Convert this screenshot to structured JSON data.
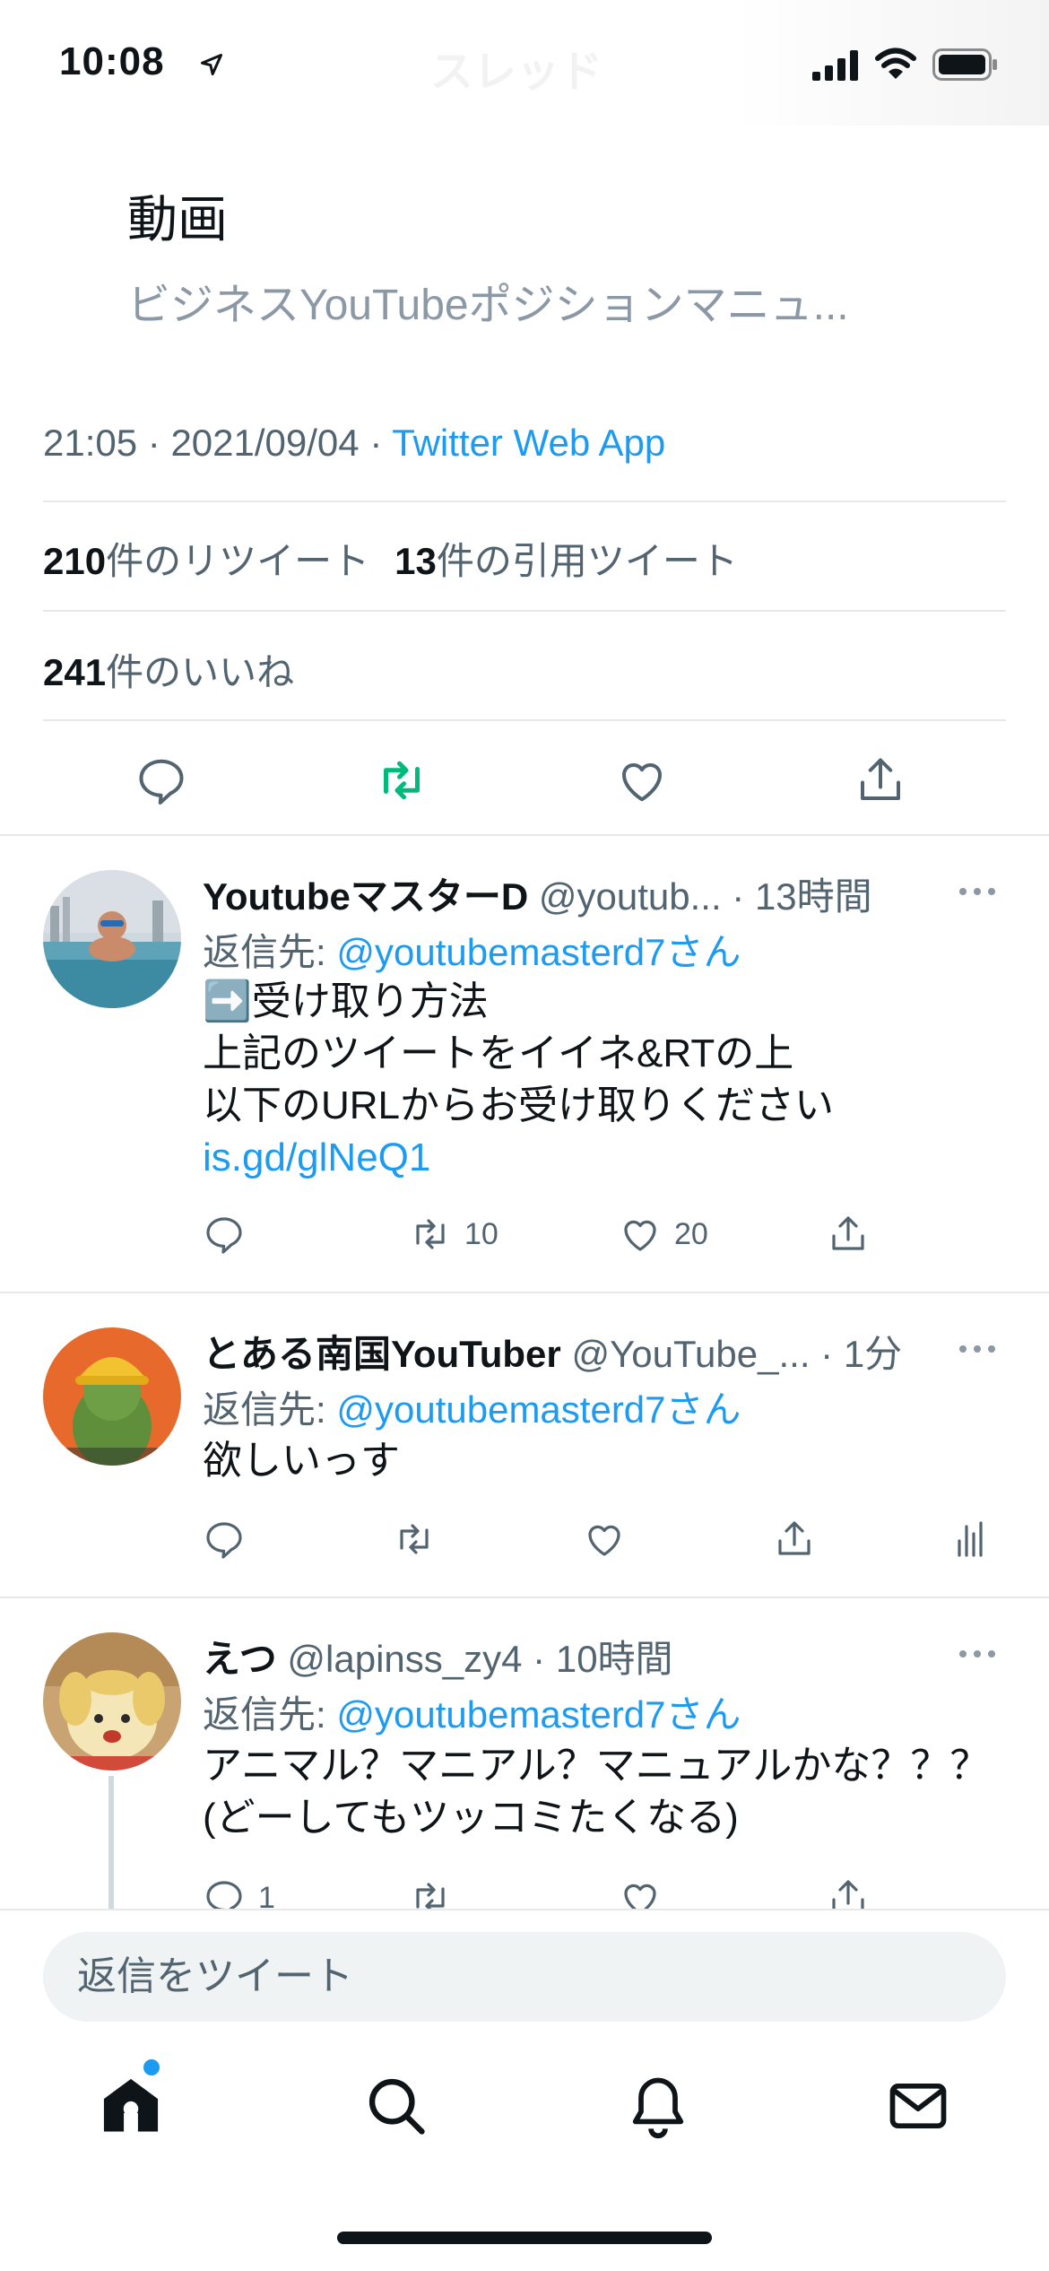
{
  "status_bar": {
    "time": "10:08",
    "header_title_ghost": "スレッド"
  },
  "quoted_card": {
    "title": "動画",
    "subtitle": "ビジネスYouTubeポジションマニュ..."
  },
  "tweet_meta": {
    "time": "21:05",
    "separator1": " · ",
    "date": "2021/09/04",
    "separator2": " · ",
    "app": "Twitter Web App"
  },
  "stats": {
    "retweets_count": "210",
    "retweets_label": "件のリツイート",
    "quotes_count": "13",
    "quotes_label": "件の引用ツイート",
    "likes_count": "241",
    "likes_label": "件のいいね"
  },
  "replies": [
    {
      "name": "YoutubeマスターD",
      "handle": "@youtub...",
      "time": " · 13時間",
      "reply_to_prefix": "返信先: ",
      "reply_to": "@youtubemasterd7さん",
      "body_line1": "➡️受け取り方法",
      "body_line2": "上記のツイートをイイネ&RTの上",
      "body_line3": "以下のURLからお受け取りください",
      "body_link": "is.gd/glNeQ1",
      "retweets": "10",
      "likes": "20"
    },
    {
      "name": "とある南国YouTuber",
      "handle": "@YouTube_...",
      "time": " · 1分",
      "reply_to_prefix": "返信先: ",
      "reply_to": "@youtubemasterd7さん",
      "body_line1": "欲しいっす"
    },
    {
      "name": "えつ",
      "handle": "@lapinss_zy4",
      "time": " · 10時間",
      "reply_to_prefix": "返信先: ",
      "reply_to": "@youtubemasterd7さん",
      "body_line1": "アニマル？マニアル？マニュアルかな？？？",
      "body_line2": "(どーしてもツッコミたくなる)",
      "replies": "1"
    }
  ],
  "composer": {
    "placeholder": "返信をツイート"
  },
  "colors": {
    "accent": "#1d9bf0",
    "retweet_active": "#00ba7c",
    "secondary": "#536471"
  },
  "icons": [
    "location-arrow-icon",
    "signal-icon",
    "wifi-icon",
    "battery-icon",
    "reply-icon",
    "retweet-icon",
    "like-icon",
    "share-icon",
    "analytics-icon",
    "more-icon",
    "home-icon",
    "search-icon",
    "notifications-icon",
    "messages-icon"
  ]
}
